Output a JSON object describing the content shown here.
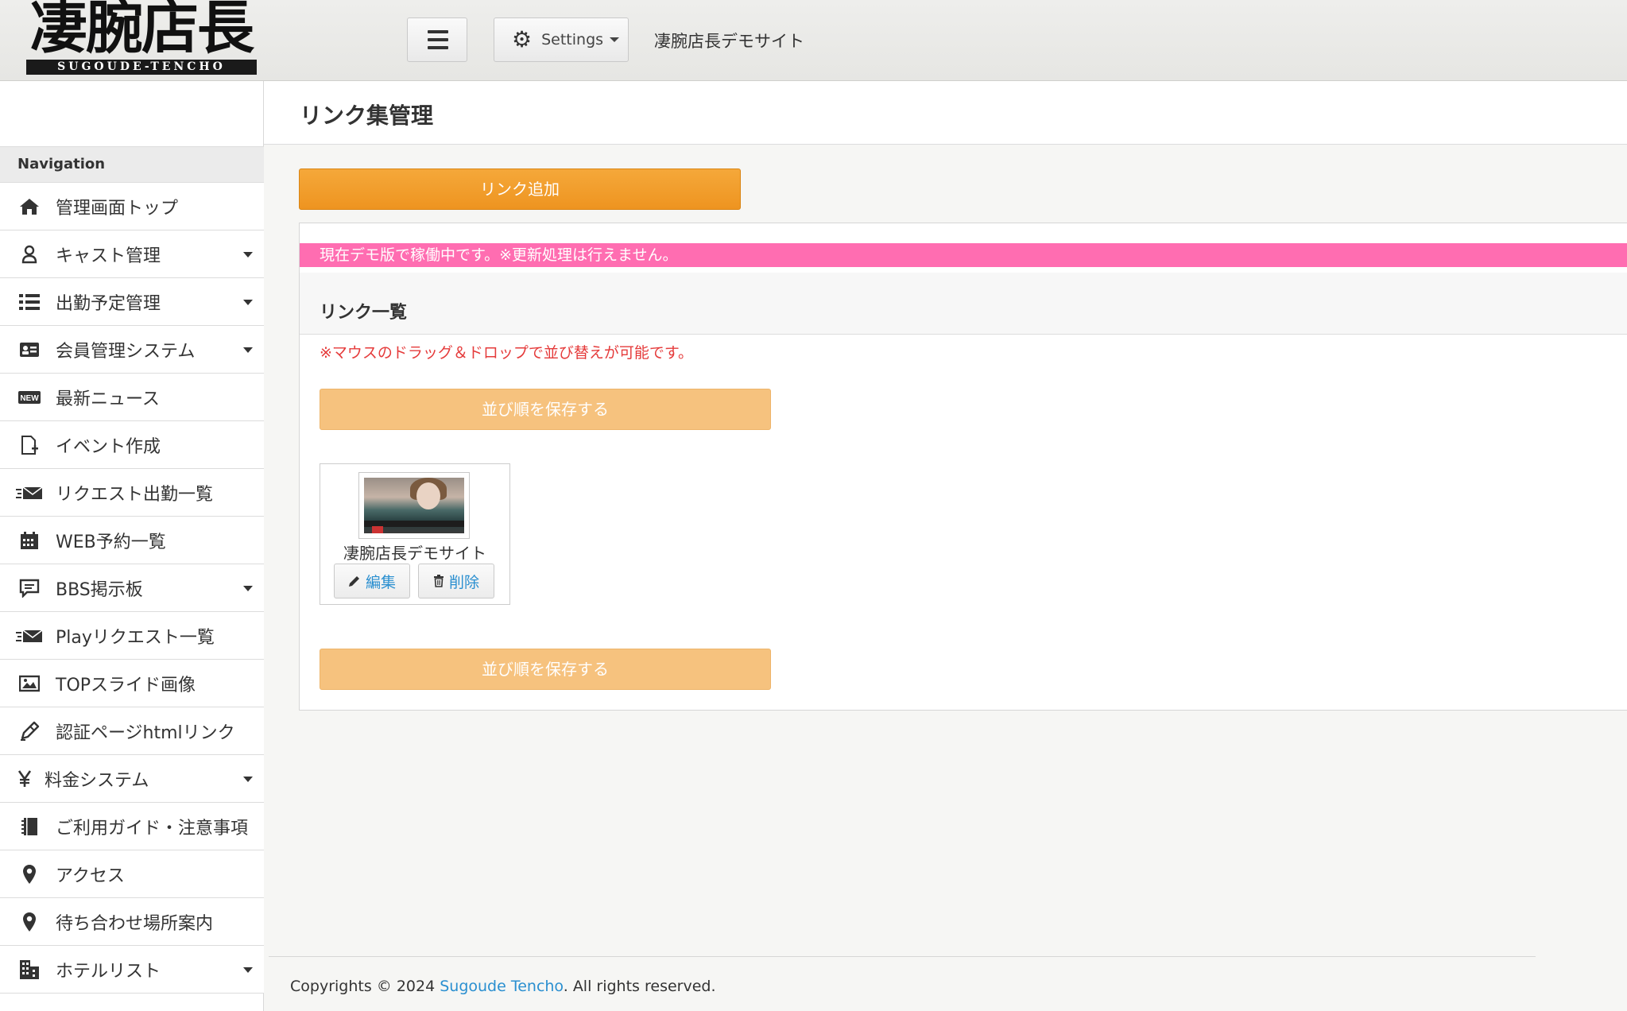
{
  "header": {
    "logo_kanji": "凄腕店長",
    "logo_romaji": "SUGOUDE-TENCHO",
    "settings_label": "Settings",
    "site_name": "凄腕店長デモサイト"
  },
  "sidebar": {
    "nav_title": "Navigation",
    "items": [
      {
        "label": "管理画面トップ",
        "icon": "home-icon",
        "has_submenu": false
      },
      {
        "label": "キャスト管理",
        "icon": "user-icon",
        "has_submenu": true
      },
      {
        "label": "出勤予定管理",
        "icon": "list-icon",
        "has_submenu": true
      },
      {
        "label": "会員管理システム",
        "icon": "id-card-icon",
        "has_submenu": true
      },
      {
        "label": "最新ニュース",
        "icon": "new-badge-icon",
        "has_submenu": false
      },
      {
        "label": "イベント作成",
        "icon": "file-add-icon",
        "has_submenu": false
      },
      {
        "label": "リクエスト出勤一覧",
        "icon": "fast-mail-icon",
        "has_submenu": false
      },
      {
        "label": "WEB予約一覧",
        "icon": "calendar-icon",
        "has_submenu": false
      },
      {
        "label": "BBS掲示板",
        "icon": "comment-icon",
        "has_submenu": true
      },
      {
        "label": "Playリクエスト一覧",
        "icon": "fast-mail-icon",
        "has_submenu": false
      },
      {
        "label": "TOPスライド画像",
        "icon": "image-icon",
        "has_submenu": false
      },
      {
        "label": "認証ページhtmlリンク",
        "icon": "pencil-icon",
        "has_submenu": false
      },
      {
        "label": "料金システム",
        "icon": "yen-icon",
        "has_submenu": true
      },
      {
        "label": "ご利用ガイド・注意事項",
        "icon": "notebook-icon",
        "has_submenu": false
      },
      {
        "label": "アクセス",
        "icon": "map-pin-icon",
        "has_submenu": false
      },
      {
        "label": "待ち合わせ場所案内",
        "icon": "map-pin-icon",
        "has_submenu": false
      },
      {
        "label": "ホテルリスト",
        "icon": "building-icon",
        "has_submenu": true
      }
    ]
  },
  "main": {
    "page_title": "リンク集管理",
    "add_button": "リンク追加",
    "demo_alert": "現在デモ版で稼働中です。※更新処理は行えません。",
    "list_title": "リンク一覧",
    "drag_note": "※マウスのドラッグ＆ドロップで並び替えが可能です。",
    "save_order_button": "並び順を保存する",
    "links": [
      {
        "name": "凄腕店長デモサイト",
        "edit_label": "編集",
        "delete_label": "削除"
      }
    ]
  },
  "footer": {
    "prefix": "Copyrights © 2024 ",
    "brand": "Sugoude Tencho",
    "suffix": ". All rights reserved."
  },
  "colors": {
    "accent_orange": "#ee9420",
    "save_button_orange": "#f6c27e",
    "alert_pink": "#ff6db1",
    "warning_red": "#e53b3b",
    "link_blue": "#2a8fd0"
  }
}
